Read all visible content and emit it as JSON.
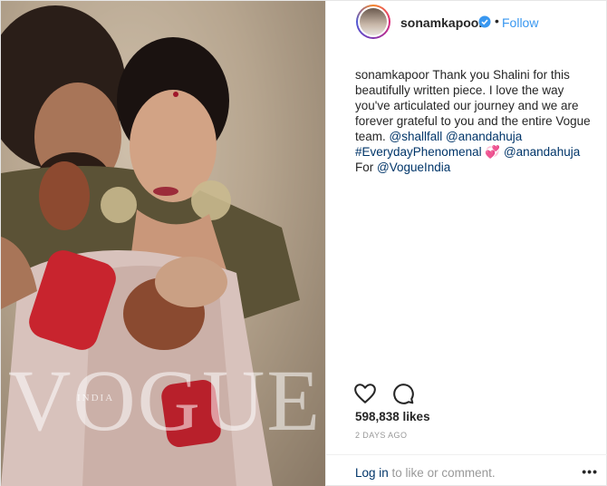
{
  "post": {
    "photo": {
      "watermark": "VOGUE",
      "watermark_sub": "INDIA"
    },
    "header": {
      "username": "sonamkapoor",
      "verified_icon": "verified-badge-icon",
      "separator": "•",
      "follow_label": "Follow"
    },
    "caption": {
      "username": "sonamkapoor",
      "text_1": " Thank you Shalini for this beautifully written piece. I love the way you've articulated our journey and we are forever grateful to you and the entire Vogue team. ",
      "mention_1": "@shallfall",
      "mention_2": "@anandahuja",
      "hashtag": "#EverydayPhenomenal",
      "emoji": "💞",
      "mention_3": "@anandahuja",
      "text_2": "For ",
      "mention_4": "@VogueIndia"
    },
    "actions": {
      "like_icon": "heart-icon",
      "comment_icon": "comment-icon"
    },
    "likes": "598,838 likes",
    "timestamp": "2 DAYS AGO",
    "footer": {
      "login_label": "Log in",
      "login_suffix": " to like or comment.",
      "more_label": "•••"
    },
    "colors": {
      "link_blue": "#3897f0",
      "mention_blue": "#003569",
      "muted": "#999999"
    }
  }
}
